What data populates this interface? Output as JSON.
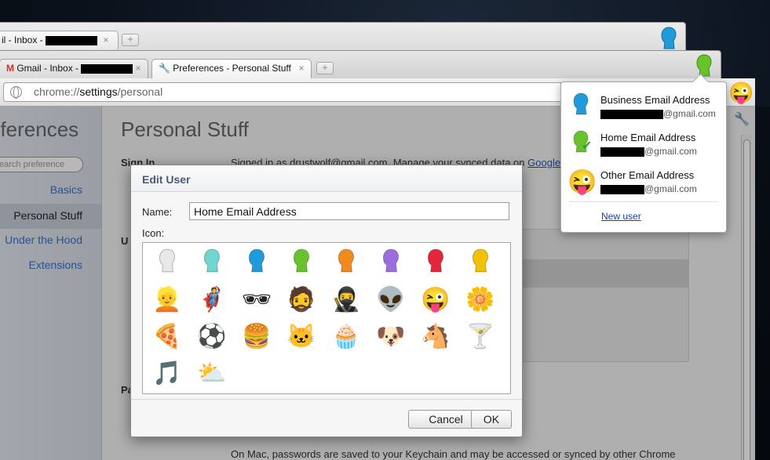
{
  "back_window": {
    "tab_label": "il - Inbox -",
    "new_tab_symbol": "+"
  },
  "middle_window": {
    "tabs": [
      {
        "label": "Gmail - Inbox -",
        "close": "×"
      },
      {
        "label": "Preferences - Personal Stuff",
        "close": "×"
      }
    ],
    "new_tab_symbol": "+"
  },
  "omnibox": {
    "scheme": "chrome://",
    "host": "settings",
    "path": "/personal"
  },
  "sidebar": {
    "title": "eferences",
    "search_placeholder": "earch preference",
    "items": [
      {
        "label": "Basics"
      },
      {
        "label": "Personal Stuff"
      },
      {
        "label": "Under the Hood"
      },
      {
        "label": "Extensions"
      }
    ]
  },
  "main": {
    "title": "Personal Stuff",
    "sign_in_label": "Sign In",
    "sign_in_text": "Signed in as drustwolf@gmail.com. Manage your synced data on",
    "sign_in_link": "Google",
    "u_label": "U",
    "p_label": "Pa",
    "footer_text": "On Mac, passwords are saved to your Keychain and may be accessed or synced by other Chrome"
  },
  "dialog": {
    "title": "Edit User",
    "name_label": "Name:",
    "name_value": "Home Email Address",
    "icon_label": "Icon:",
    "icons": [
      {
        "name": "white-head-icon",
        "glyph": "👤",
        "color": "#e8e8e8"
      },
      {
        "name": "aqua-head-icon",
        "glyph": "👤",
        "color": "#6fd6d0"
      },
      {
        "name": "blue-head-icon",
        "glyph": "👤",
        "color": "#1f9bdc"
      },
      {
        "name": "green-head-icon",
        "glyph": "👤",
        "color": "#68c22c"
      },
      {
        "name": "orange-head-icon",
        "glyph": "👤",
        "color": "#f08a1c"
      },
      {
        "name": "purple-head-icon",
        "glyph": "👤",
        "color": "#9b6de0"
      },
      {
        "name": "red-head-icon",
        "glyph": "👤",
        "color": "#e3263c"
      },
      {
        "name": "yellow-head-icon",
        "glyph": "👤",
        "color": "#f2c200"
      },
      {
        "name": "blonde-woman-icon",
        "glyph": "👱",
        "color": ""
      },
      {
        "name": "superhero-icon",
        "glyph": "🦸",
        "color": ""
      },
      {
        "name": "woman-sunglasses-icon",
        "glyph": "🕶",
        "color": ""
      },
      {
        "name": "man-icon",
        "glyph": "🧔",
        "color": ""
      },
      {
        "name": "ninja-icon",
        "glyph": "🥷",
        "color": ""
      },
      {
        "name": "alien-icon",
        "glyph": "👽",
        "color": ""
      },
      {
        "name": "smiley-icon",
        "glyph": "😜",
        "color": ""
      },
      {
        "name": "flower-icon",
        "glyph": "🌼",
        "color": ""
      },
      {
        "name": "pizza-icon",
        "glyph": "🍕",
        "color": ""
      },
      {
        "name": "soccer-ball-icon",
        "glyph": "⚽",
        "color": ""
      },
      {
        "name": "burger-icon",
        "glyph": "🍔",
        "color": ""
      },
      {
        "name": "cat-icon",
        "glyph": "🐱",
        "color": ""
      },
      {
        "name": "cupcake-icon",
        "glyph": "🧁",
        "color": ""
      },
      {
        "name": "dog-icon",
        "glyph": "🐶",
        "color": ""
      },
      {
        "name": "horse-icon",
        "glyph": "🐴",
        "color": ""
      },
      {
        "name": "cocktail-icon",
        "glyph": "🍸",
        "color": ""
      },
      {
        "name": "music-note-icon",
        "glyph": "🎵",
        "color": ""
      },
      {
        "name": "sun-cloud-icon",
        "glyph": "⛅",
        "color": ""
      }
    ],
    "cancel_label": "Cancel",
    "ok_label": "OK"
  },
  "user_menu": {
    "users": [
      {
        "name": "Business Email Address",
        "email_suffix": "@gmail.com",
        "icon": "blue-head-icon",
        "glyph": "👤",
        "color": "#1f9bdc"
      },
      {
        "name": "Home Email Address",
        "email_suffix": "@gmail.com",
        "icon": "green-head-icon",
        "glyph": "👤",
        "color": "#68c22c"
      },
      {
        "name": "Other Email Address",
        "email_suffix": "@gmail.com",
        "icon": "smiley-icon",
        "glyph": "😜",
        "color": ""
      }
    ],
    "new_user_label": "New user"
  },
  "colors": {
    "accent_link": "#3b6fc4",
    "dialog_title": "#4a5a78",
    "avatar_back_window": "#1f9bdc",
    "avatar_mid_window": "#68c22c"
  }
}
